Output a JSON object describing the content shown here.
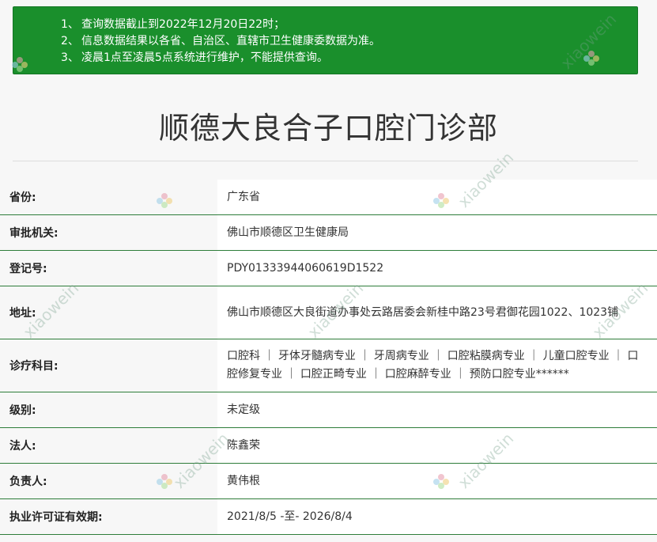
{
  "notice": {
    "lines": [
      {
        "num": "1、",
        "text": "查询数据截止到2022年12月20日22时；"
      },
      {
        "num": "2、",
        "text": "信息数据结果以各省、自治区、直辖市卫生健康委数据为准。"
      },
      {
        "num": "3、",
        "text": "凌晨1点至凌晨5点系统进行维护，不能提供查询。"
      }
    ],
    "background_color": "#1a8f2c"
  },
  "title": "顺德大良合子口腔门诊部",
  "watermark_text": "xiaowein",
  "rows": [
    {
      "label": "省份:",
      "value": "广东省"
    },
    {
      "label": "审批机关:",
      "value": "佛山市顺德区卫生健康局"
    },
    {
      "label": "登记号:",
      "value": "PDY01333944060619D1522"
    },
    {
      "label": "地址:",
      "value": "佛山市顺德区大良街道办事处云路居委会新桂中路23号君御花园1022、1023铺"
    },
    {
      "label": "诊疗科目:",
      "value": "口腔科 ｜ 牙体牙髓病专业 ｜ 牙周病专业 ｜ 口腔粘膜病专业 ｜ 儿童口腔专业 ｜ 口腔修复专业 ｜ 口腔正畸专业 ｜ 口腔麻醉专业 ｜ 预防口腔专业******"
    },
    {
      "label": "级别:",
      "value": "未定级"
    },
    {
      "label": "法人:",
      "value": "陈鑫荣"
    },
    {
      "label": "负责人:",
      "value": "黄伟根"
    },
    {
      "label": "执业许可证有效期:",
      "value": "2021/8/5 -至- 2026/8/4"
    }
  ]
}
